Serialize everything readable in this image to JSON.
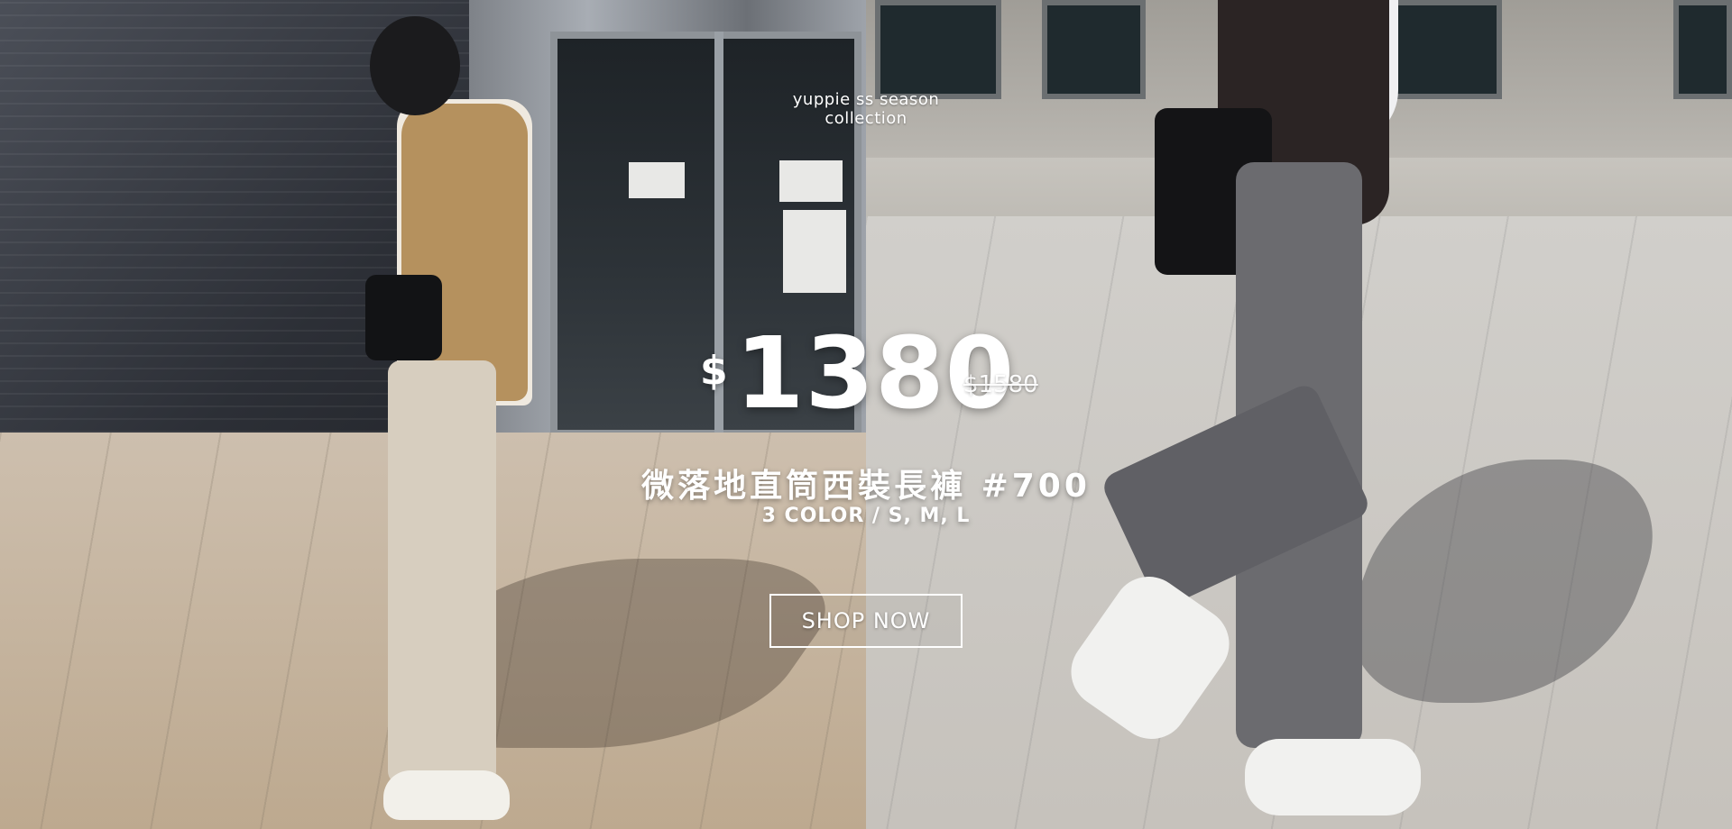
{
  "banner": {
    "collection_text": "yuppie ss season collection",
    "currency_symbol": "$",
    "price": "1380",
    "original_price": "$1580",
    "title": "微落地直筒西裝長褲 #700",
    "subtitle": "3 COLOR / S, M, L",
    "cta_label": "SHOP NOW"
  }
}
